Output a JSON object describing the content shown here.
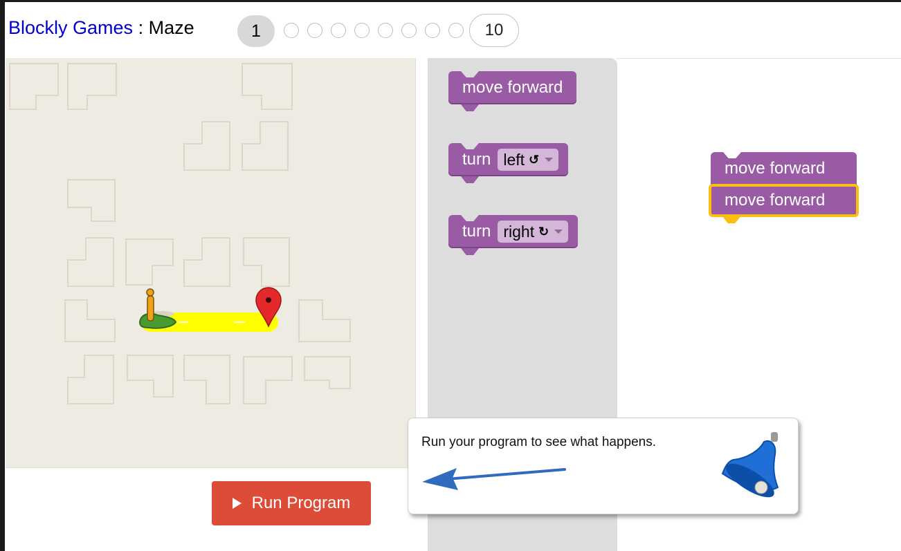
{
  "header": {
    "app_name": "Blockly Games",
    "separator": " : ",
    "game_name": "Maze",
    "current_level": "1",
    "last_level": "10",
    "level_dots": 8
  },
  "maze": {
    "start_icon": "pegman-icon",
    "goal_icon": "map-marker-icon",
    "path_color": "#ffff00"
  },
  "run_button": {
    "label": "Run Program",
    "icon": "play-icon",
    "color": "#dd4b39"
  },
  "toolbox": {
    "blocks": [
      {
        "label": "move forward"
      },
      {
        "label": "turn",
        "dropdown": "left",
        "dropdown_arrow": "↺"
      },
      {
        "label": "turn",
        "dropdown": "right",
        "dropdown_arrow": "↻"
      }
    ]
  },
  "workspace": {
    "blocks": [
      {
        "label": "move forward",
        "selected": false
      },
      {
        "label": "move forward",
        "selected": true
      }
    ]
  },
  "hint": {
    "text": "Run your program to see what happens.",
    "icon": "bell-icon",
    "pointer": "left-arrow-icon"
  },
  "colors": {
    "block": "#9a5ba5",
    "link": "#0000cc",
    "selection": "#f9c011"
  }
}
